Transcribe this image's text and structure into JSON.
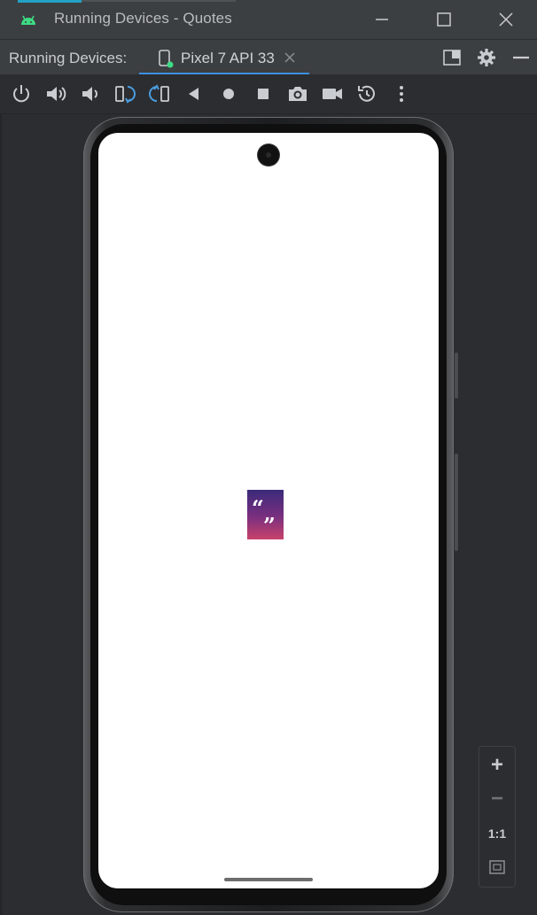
{
  "window": {
    "title": "Running Devices - Quotes",
    "minimize_icon": "minimize-icon",
    "maximize_icon": "maximize-icon",
    "close_icon": "close-icon",
    "brand_color": "#3ddc84"
  },
  "panel": {
    "label": "Running Devices:",
    "tab": {
      "label": "Pixel 7 API 33",
      "icon": "device-icon",
      "close_icon": "close-icon",
      "underline_color": "#3d8fe0"
    },
    "actions": [
      "layout-icon",
      "gear-icon",
      "hide-icon"
    ]
  },
  "device_toolbar": {
    "icons": [
      "power-icon",
      "volume-up-icon",
      "volume-down-icon",
      "rotate-left-icon",
      "rotate-right-icon",
      "back-icon",
      "home-icon",
      "overview-icon",
      "screenshot-icon",
      "screen-record-icon",
      "snapshot-icon",
      "more-icon"
    ]
  },
  "device_screen": {
    "app_logo": {
      "open_quote": "“",
      "close_quote": "”",
      "gradient_top": "#3b2a7a",
      "gradient_bottom": "#c8426a"
    }
  },
  "zoom_controls": {
    "zoom_in": "+",
    "zoom_out": "−",
    "actual_size": "1:1",
    "fit_icon": "fit-screen-icon"
  }
}
